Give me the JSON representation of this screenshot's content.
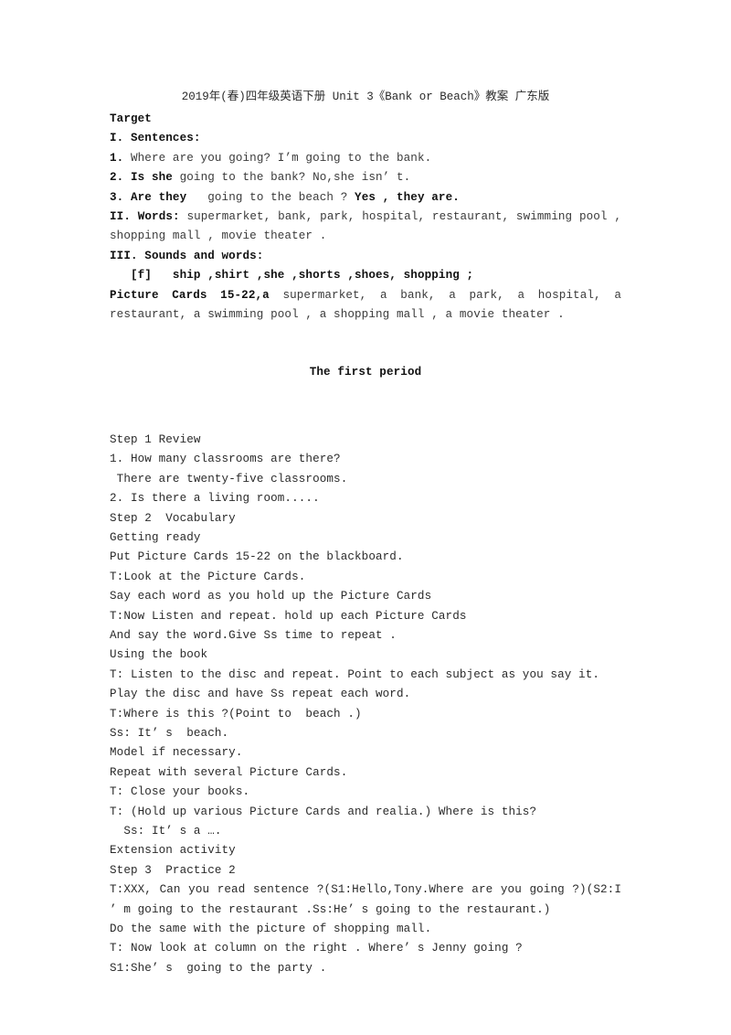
{
  "document": {
    "title": "2019年(春)四年级英语下册 Unit 3《Bank or Beach》教案 广东版",
    "section_heading_target": "Target",
    "heading_sentences": "I. Sentences:",
    "sentence1": {
      "num": "1. ",
      "text": "Where are you going? I’m going to the bank."
    },
    "sentence2": {
      "num": "2. ",
      "bold": "Is she",
      "rest": " going to the bank? No,she isn’ t."
    },
    "sentence3": {
      "num": "3. ",
      "bold": "Are they",
      "mid": "   going to the beach ? ",
      "bold2": "Yes , they are."
    },
    "words_label": "II.  Words:",
    "words_list": " supermarket, bank, park, hospital, restaurant, swimming pool , shopping mall , movie theater .",
    "sounds_heading": "III. Sounds and words:",
    "sounds_line": "   [f]   ship ,shirt ,she ,shorts ,shoes, shopping ;",
    "picture_cards_bold": "  Picture Cards 15-22,a",
    "picture_cards_rest": " supermarket, a bank, a  park, a  hospital, a restaurant, a  swimming pool , a  shopping mall , a  movie  theater .",
    "period_heading": "The first period",
    "body_lines": [
      "Step 1 Review",
      "1. How many classrooms are there?",
      " There are twenty-five classrooms.",
      "2. Is there a living room.....",
      "Step 2  Vocabulary",
      "Getting ready",
      "Put Picture Cards 15-22 on the blackboard.",
      "T:Look at the Picture Cards.",
      "Say each word as you hold up the Picture Cards",
      "T:Now Listen and repeat. hold up each Picture Cards",
      "And say the word.Give Ss time to repeat .",
      "Using the book",
      "T: Listen to the disc and repeat. Point to each subject as you say it.",
      "Play the disc and have Ss repeat each word.",
      "T:Where is this ?(Point to  beach .)",
      "Ss: It’ s  beach.",
      "Model if necessary.",
      "Repeat with several Picture Cards.",
      "T: Close your books.",
      "T: (Hold up various Picture Cards and realia.) Where is this?",
      "  Ss: It’ s a ….",
      "Extension activity",
      "Step 3  Practice 2"
    ],
    "practice_line_justified": "T:XXX, Can you read sentence ?(S1:Hello,Tony.Where are you going ?)(S2:I ’ m going to the restaurant .Ss:He’ s  going to the restaurant.)",
    "tail_lines": [
      "Do the same with the picture of shopping mall.",
      "T: Now look at column on the right . Where’ s Jenny going ?",
      "S1:She’ s  going to the party ."
    ]
  }
}
